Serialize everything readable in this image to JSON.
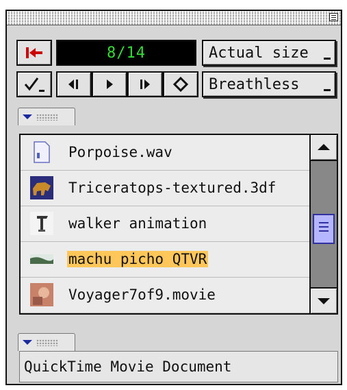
{
  "toolbar": {
    "counter": "8/14",
    "size_popup": "Actual size",
    "effect_popup": "Breathless"
  },
  "icons": {
    "go_to_start": "go-to-start-icon",
    "checkmark_menu": "checkmark-icon",
    "step_back": "step-back-icon",
    "play": "play-icon",
    "step_forward": "step-forward-icon",
    "diamond": "diamond-icon"
  },
  "files": [
    {
      "name": "Porpoise.wav",
      "icon": "sound-file-icon",
      "selected": false
    },
    {
      "name": "Triceratops-textured.3df",
      "icon": "3d-model-thumbnail",
      "selected": false
    },
    {
      "name": "walker animation",
      "icon": "animation-thumbnail",
      "selected": false
    },
    {
      "name": "machu picho QTVR",
      "icon": "qtvr-thumbnail",
      "selected": true
    },
    {
      "name": "Voyager7of9.movie",
      "icon": "movie-thumbnail",
      "selected": false
    }
  ],
  "scroll_position": 0.55,
  "status": {
    "text": "QuickTime Movie  Document"
  },
  "colors": {
    "counter_text": "#33dd33",
    "highlight": "#ffc659",
    "accent_red": "#cc0000",
    "tab_triangle": "#1b2a9e",
    "scroll_thumb": "#b6b6ff"
  }
}
